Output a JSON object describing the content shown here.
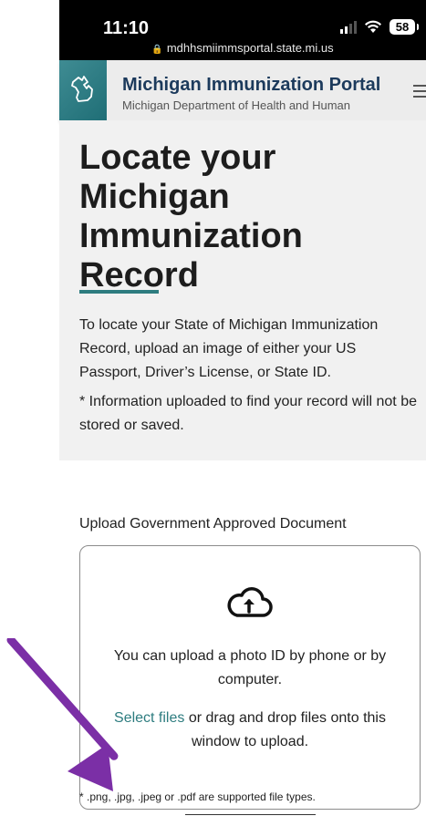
{
  "status_bar": {
    "time": "11:10",
    "battery": "58",
    "url": "mdhhsmiimmsportal.state.mi.us"
  },
  "header": {
    "title": "Michigan Immunization Portal",
    "subtitle": "Michigan Department of Health and Human",
    "logo_color": "#2f7f86"
  },
  "hero": {
    "title": "Locate your Michigan Immunization Record",
    "description": "To locate your State of Michigan Immunization Record, upload an image of either your US Passport, Driver’s License, or State ID.",
    "note": "* Information uploaded to find your record will not be stored or saved."
  },
  "upload": {
    "label": "Upload Government Approved Document",
    "line1": "You can upload a photo ID by phone or by computer.",
    "select_files": "Select files",
    "line2_rest": " or drag and drop files onto this window to upload.",
    "file_types": "* .png, .jpg, .jpeg or .pdf are supported file types."
  },
  "colors": {
    "accent": "#2d7c7f",
    "annotation_arrow": "#7b2fa6"
  }
}
